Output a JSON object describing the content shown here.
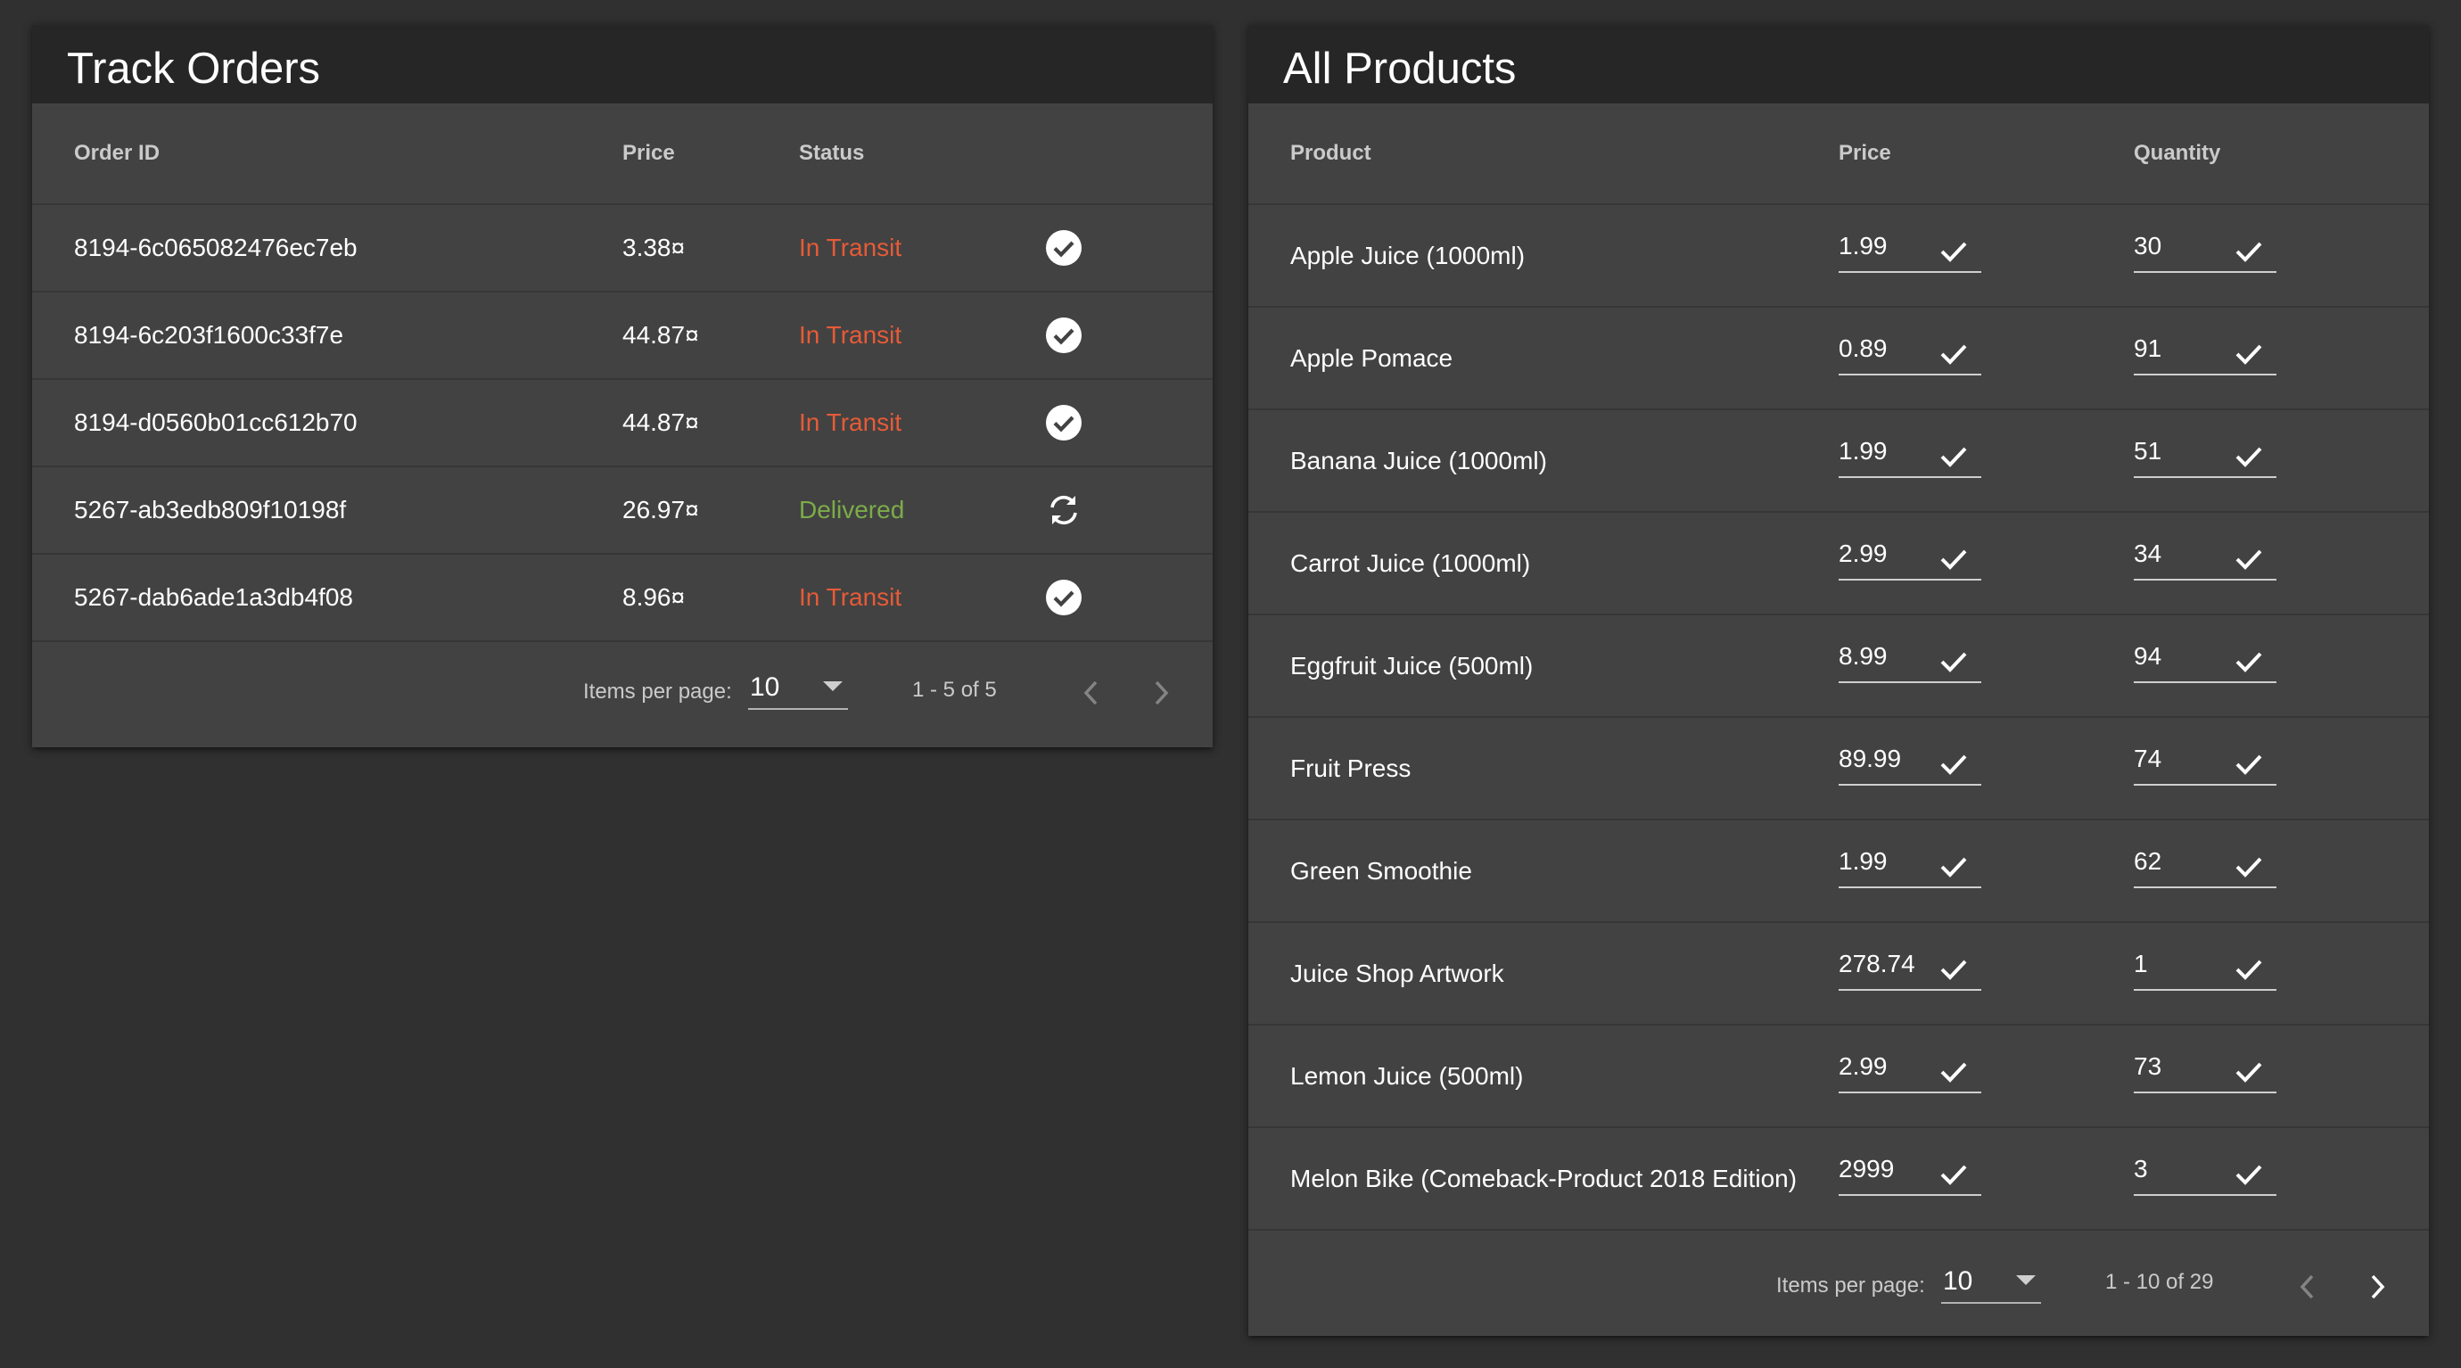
{
  "track_orders": {
    "title": "Track Orders",
    "columns": {
      "order_id": "Order ID",
      "price": "Price",
      "status": "Status"
    },
    "rows": [
      {
        "order_id": "8194-6c065082476ec7eb",
        "price": "3.38¤",
        "status": "In Transit",
        "status_kind": "transit",
        "action_icon": "check-circle-icon"
      },
      {
        "order_id": "8194-6c203f1600c33f7e",
        "price": "44.87¤",
        "status": "In Transit",
        "status_kind": "transit",
        "action_icon": "check-circle-icon"
      },
      {
        "order_id": "8194-d0560b01cc612b70",
        "price": "44.87¤",
        "status": "In Transit",
        "status_kind": "transit",
        "action_icon": "check-circle-icon"
      },
      {
        "order_id": "5267-ab3edb809f10198f",
        "price": "26.97¤",
        "status": "Delivered",
        "status_kind": "delivered",
        "action_icon": "sync-icon"
      },
      {
        "order_id": "5267-dab6ade1a3db4f08",
        "price": "8.96¤",
        "status": "In Transit",
        "status_kind": "transit",
        "action_icon": "check-circle-icon"
      }
    ],
    "paginator": {
      "items_per_page_label": "Items per page:",
      "page_size": "10",
      "range_label": "1 - 5 of 5"
    }
  },
  "all_products": {
    "title": "All Products",
    "columns": {
      "product": "Product",
      "price": "Price",
      "quantity": "Quantity"
    },
    "rows": [
      {
        "product": "Apple Juice (1000ml)",
        "price": "1.99",
        "quantity": "30"
      },
      {
        "product": "Apple Pomace",
        "price": "0.89",
        "quantity": "91"
      },
      {
        "product": "Banana Juice (1000ml)",
        "price": "1.99",
        "quantity": "51"
      },
      {
        "product": "Carrot Juice (1000ml)",
        "price": "2.99",
        "quantity": "34"
      },
      {
        "product": "Eggfruit Juice (500ml)",
        "price": "8.99",
        "quantity": "94"
      },
      {
        "product": "Fruit Press",
        "price": "89.99",
        "quantity": "74"
      },
      {
        "product": "Green Smoothie",
        "price": "1.99",
        "quantity": "62"
      },
      {
        "product": "Juice Shop Artwork",
        "price": "278.74",
        "quantity": "1"
      },
      {
        "product": "Lemon Juice (500ml)",
        "price": "2.99",
        "quantity": "73"
      },
      {
        "product": "Melon Bike (Comeback-Product 2018 Edition)",
        "price": "2999",
        "quantity": "3"
      }
    ],
    "paginator": {
      "items_per_page_label": "Items per page:",
      "page_size": "10",
      "range_label": "1 - 10 of 29"
    }
  },
  "colors": {
    "status_in_transit": "#e65b37",
    "status_delivered": "#7cac49",
    "background": "#303030",
    "card": "#424242",
    "card_header": "#262626"
  },
  "icons": {
    "confirm": "check-icon",
    "order_done": "check-circle-icon",
    "order_refresh": "sync-icon",
    "select_arrow": "dropdown-arrow-icon",
    "prev": "chevron-left-icon",
    "next": "chevron-right-icon"
  }
}
